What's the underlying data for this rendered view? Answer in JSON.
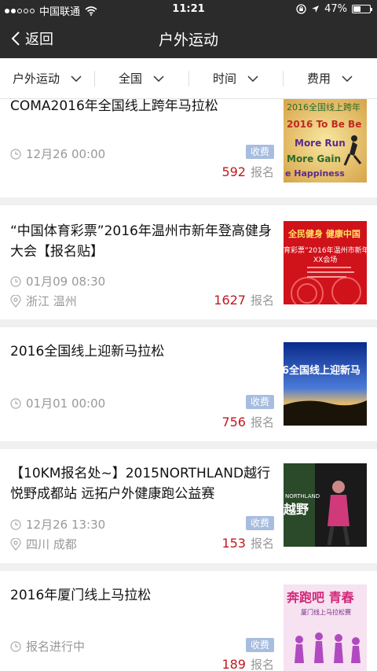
{
  "status_bar": {
    "carrier": "中国联通",
    "time": "11:21",
    "battery": "47%",
    "battery_level": 0.47
  },
  "nav": {
    "back_label": "返回",
    "title": "户外运动"
  },
  "filters": [
    {
      "label": "户外运动"
    },
    {
      "label": "全国"
    },
    {
      "label": "时间"
    },
    {
      "label": "费用"
    }
  ],
  "events": [
    {
      "title": "COMA2016年全国线上跨年马拉松",
      "time": "12月26 00:00",
      "location": "",
      "badge": "收费",
      "count": "592",
      "count_label": "报名",
      "thumb_text": [
        "2016全国线上跨年",
        "2016 To Be Be",
        "More Run",
        "More Gain",
        "e Happiness"
      ]
    },
    {
      "title": "“中国体育彩票”2016年温州市新年登高健身大会【报名贴】",
      "time": "01月09 08:30",
      "location": "浙江 温州",
      "badge": "",
      "count": "1627",
      "count_label": "报名",
      "thumb_text": [
        "全民健身 健康中国",
        "育彩票”2016年温州市新年登高",
        "XX会场"
      ]
    },
    {
      "title": "2016全国线上迎新马拉松",
      "time": "01月01 00:00",
      "location": "",
      "badge": "收费",
      "count": "756",
      "count_label": "报名",
      "thumb_text": [
        "6全国线上迎新马"
      ]
    },
    {
      "title": "【10KM报名处~】2015NORTHLAND越行悦野成都站 远拓户外健康跑公益赛",
      "time": "12月26 13:30",
      "location": "四川 成都",
      "badge": "收费",
      "count": "153",
      "count_label": "报名",
      "thumb_text": [
        "越野",
        "NORTHLAND"
      ]
    },
    {
      "title": "2016年厦门线上马拉松",
      "time": "报名进行中",
      "location": "",
      "badge": "收费",
      "count": "189",
      "count_label": "报名",
      "thumb_text": [
        "奔跑吧 青春",
        "厦门线上马拉松赛"
      ]
    }
  ]
}
